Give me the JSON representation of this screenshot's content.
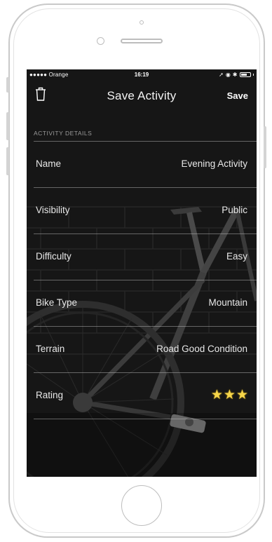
{
  "status_bar": {
    "carrier": "●●●●● Orange",
    "time": "16:19"
  },
  "nav": {
    "title": "Save Activity",
    "save_label": "Save",
    "left_icon": "trash-icon"
  },
  "section": {
    "header": "ACTIVITY DETAILS"
  },
  "rows": [
    {
      "label": "Name",
      "value": "Evening Activity"
    },
    {
      "label": "Visibility",
      "value": "Public"
    },
    {
      "label": "Difficulty",
      "value": "Easy"
    },
    {
      "label": "Bike Type",
      "value": "Mountain"
    },
    {
      "label": "Terrain",
      "value": "Road Good Condition"
    },
    {
      "label": "Rating",
      "rating": 3,
      "rating_max": 3
    }
  ],
  "colors": {
    "star": "#f7d64a",
    "screen_bg": "#141414",
    "frame": "#c9c9c9"
  }
}
